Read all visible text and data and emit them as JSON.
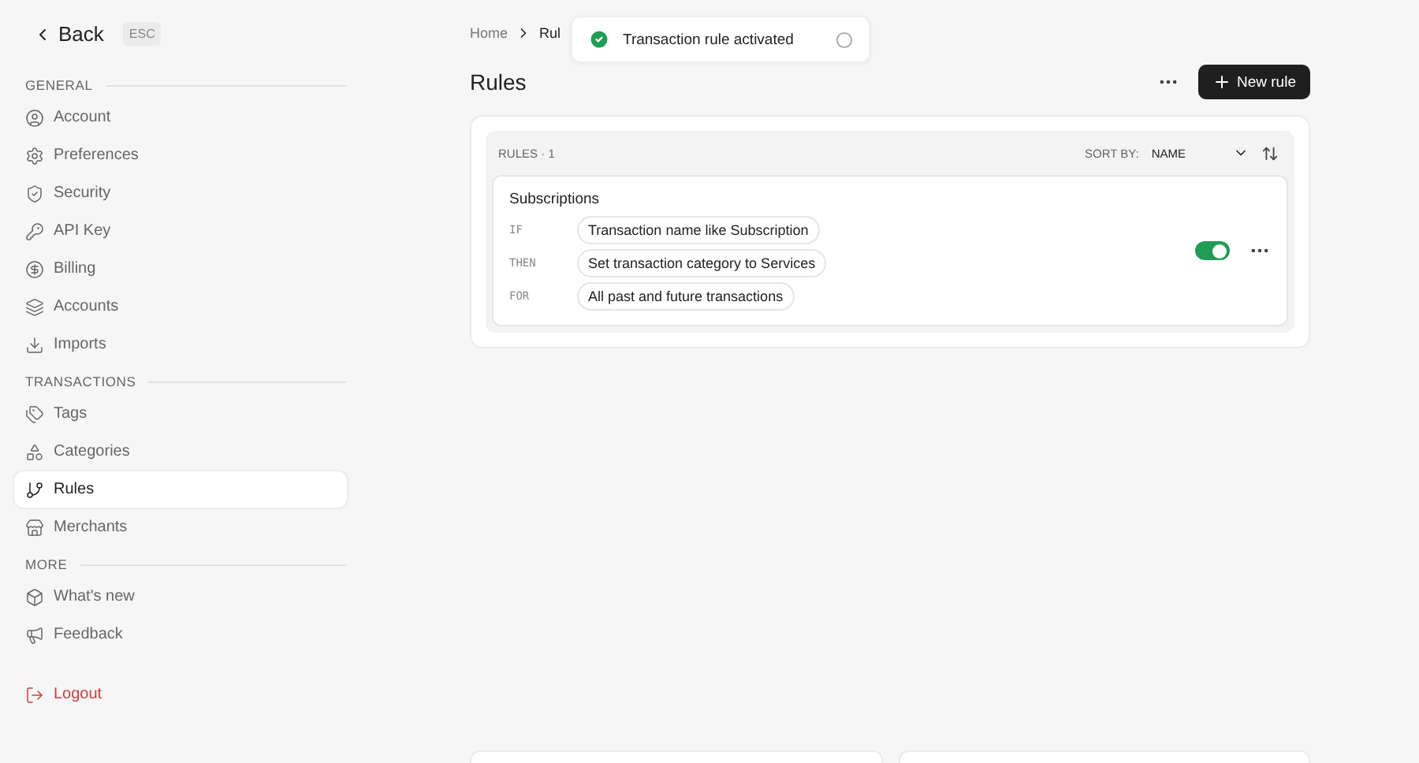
{
  "back": {
    "label": "Back",
    "shortcut": "ESC"
  },
  "sidebar": {
    "sections": [
      {
        "title": "GENERAL",
        "items": [
          {
            "label": "Account",
            "selected": false
          },
          {
            "label": "Preferences",
            "selected": false
          },
          {
            "label": "Security",
            "selected": false
          },
          {
            "label": "API Key",
            "selected": false
          },
          {
            "label": "Billing",
            "selected": false
          },
          {
            "label": "Accounts",
            "selected": false
          },
          {
            "label": "Imports",
            "selected": false
          }
        ]
      },
      {
        "title": "TRANSACTIONS",
        "items": [
          {
            "label": "Tags",
            "selected": false
          },
          {
            "label": "Categories",
            "selected": false
          },
          {
            "label": "Rules",
            "selected": true
          },
          {
            "label": "Merchants",
            "selected": false
          }
        ]
      },
      {
        "title": "MORE",
        "items": [
          {
            "label": "What's new",
            "selected": false
          },
          {
            "label": "Feedback",
            "selected": false
          }
        ]
      }
    ],
    "logout": "Logout"
  },
  "breadcrumb": [
    "Home",
    "Rul"
  ],
  "toast": {
    "message": "Transaction rule activated"
  },
  "page_title": "Rules",
  "new_button": "New rule",
  "rules_panel": {
    "label": "RULES",
    "separator": "·",
    "count": "1",
    "sort_label": "SORT BY:",
    "sort_value": "NAME",
    "rules": [
      {
        "name": "Subscriptions",
        "enabled": true,
        "clauses": [
          {
            "keyword": "IF",
            "text": "Transaction name like Subscription"
          },
          {
            "keyword": "THEN",
            "text": "Set transaction category to Services"
          },
          {
            "keyword": "FOR",
            "text": "All past and future transactions"
          }
        ]
      }
    ]
  }
}
